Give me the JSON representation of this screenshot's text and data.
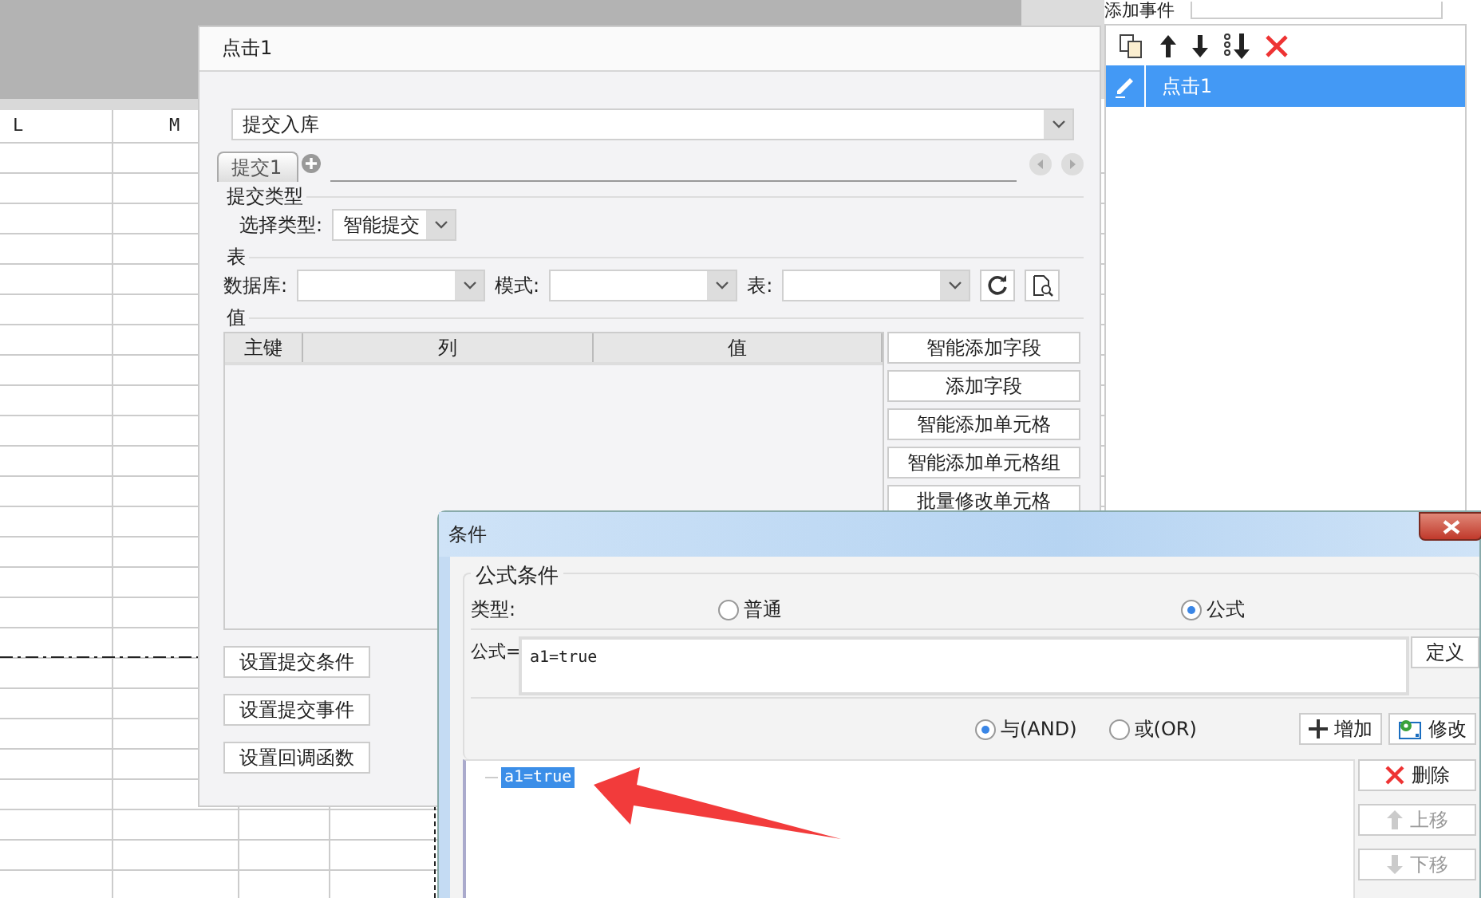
{
  "sheet": {
    "columns": [
      "L",
      "M"
    ]
  },
  "event_panel": {
    "title": "添加事件",
    "events": [
      {
        "label": "点击1",
        "selected": true
      }
    ]
  },
  "dialog": {
    "title": "点击1",
    "action": "提交入库",
    "tabs": [
      {
        "label": "提交1",
        "selected": true
      }
    ],
    "submit_type": {
      "legend": "提交类型",
      "label": "选择类型:",
      "value": "智能提交"
    },
    "table_section": {
      "legend": "表",
      "fields": [
        "数据库:",
        "模式:",
        "表:"
      ]
    },
    "values_section": {
      "legend": "值",
      "columns": [
        "主键",
        "列",
        "值"
      ],
      "buttons": [
        "智能添加字段",
        "添加字段",
        "智能添加单元格",
        "智能添加单元格组",
        "批量修改单元格"
      ]
    },
    "bottom_buttons": [
      "设置提交条件",
      "设置提交事件",
      "设置回调函数"
    ]
  },
  "condition_dialog": {
    "title": "条件",
    "legend": "公式条件",
    "type_label": "类型:",
    "types": [
      {
        "label": "普通",
        "selected": false
      },
      {
        "label": "公式",
        "selected": true
      }
    ],
    "formula_label": "公式=",
    "formula": "a1=true",
    "define_button": "定义",
    "logic": [
      {
        "label": "与(AND)",
        "selected": true
      },
      {
        "label": "或(OR)",
        "selected": false
      }
    ],
    "actions": [
      {
        "kind": "add",
        "label": "增加",
        "disabled": false
      },
      {
        "kind": "edit",
        "label": "修改",
        "disabled": false
      }
    ],
    "conditions": [
      {
        "label": "a1=true",
        "selected": true
      }
    ],
    "side_buttons": [
      {
        "kind": "delete",
        "label": "删除",
        "disabled": false
      },
      {
        "kind": "up",
        "label": "上移",
        "disabled": true
      },
      {
        "kind": "down",
        "label": "下移",
        "disabled": true
      }
    ]
  }
}
